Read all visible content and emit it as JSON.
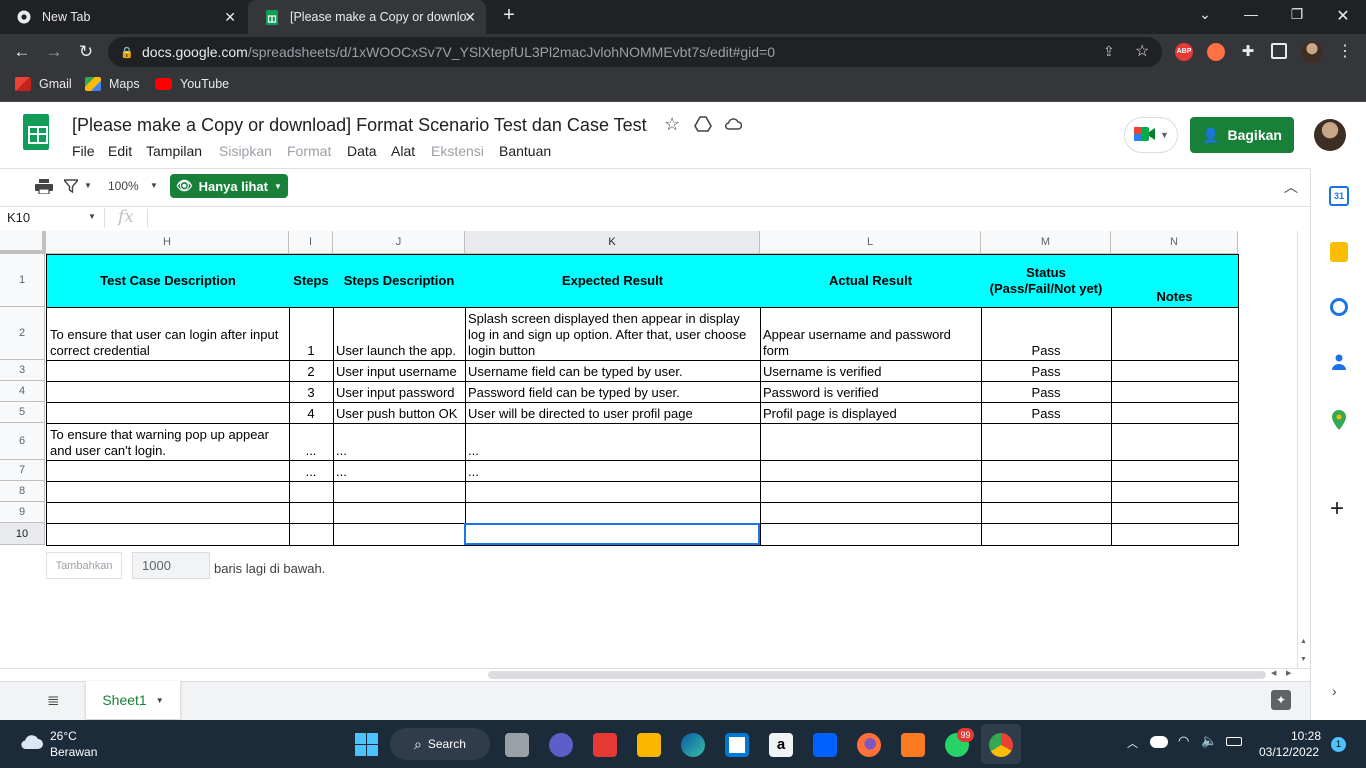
{
  "browser": {
    "tabs": [
      {
        "title": "New Tab"
      },
      {
        "title": "[Please make a Copy or downloa"
      }
    ],
    "url_host": "docs.google.com",
    "url_path": "/spreadsheets/d/1xWOOCxSv7V_YSlXtepfUL3Pl2macJvlohNOMMEvbt7s/edit#gid=0",
    "bookmarks": [
      {
        "label": "Gmail"
      },
      {
        "label": "Maps"
      },
      {
        "label": "YouTube"
      }
    ],
    "abp_label": "ABP"
  },
  "doc": {
    "title": "[Please make a Copy or download] Format  Scenario Test dan Case Test",
    "menus": [
      "File",
      "Edit",
      "Tampilan",
      "Sisipkan",
      "Format",
      "Data",
      "Alat",
      "Ekstensi",
      "Bantuan"
    ],
    "share_label": "Bagikan",
    "zoom": "100%",
    "view_only_label": "Hanya lihat",
    "name_box": "K10",
    "fx_label": "fx"
  },
  "sheet": {
    "columns": [
      "H",
      "I",
      "J",
      "K",
      "L",
      "M",
      "N"
    ],
    "rows": [
      "1",
      "2",
      "3",
      "4",
      "5",
      "6",
      "7",
      "8",
      "9",
      "10"
    ],
    "header": [
      "Test Case Description",
      "Steps",
      "Steps Description",
      "Expected Result",
      "Actual Result",
      "Status (Pass/Fail/Not yet)",
      "Notes"
    ],
    "data": [
      [
        "To ensure that user can login after input correct credential",
        "1",
        "User launch the app.",
        "Splash screen displayed then appear in display log in and sign up option. After that, user choose login button",
        "Appear username and password form",
        "Pass",
        ""
      ],
      [
        "",
        "2",
        "User input username",
        "Username field can be typed by user.",
        "Username is verified",
        "Pass",
        ""
      ],
      [
        "",
        "3",
        "User input password",
        "Password field can be typed by user.",
        "Password is verified",
        "Pass",
        ""
      ],
      [
        "",
        "4",
        "User push button OK",
        "User will be directed to user profil page",
        "Profil page is displayed",
        "Pass",
        ""
      ],
      [
        "To ensure that warning pop up appear and user can't login.",
        "...",
        "...",
        "...",
        "",
        "",
        ""
      ],
      [
        "",
        "...",
        "...",
        "...",
        "",
        "",
        ""
      ],
      [
        "",
        "",
        "",
        "",
        "",
        "",
        ""
      ],
      [
        "",
        "",
        "",
        "",
        "",
        "",
        ""
      ],
      [
        "",
        "",
        "",
        "",
        "",
        "",
        ""
      ]
    ],
    "add_label": "Tambahkan",
    "add_count": "1000",
    "add_suffix": "baris lagi di bawah.",
    "sheet_tab": "Sheet1"
  },
  "taskbar": {
    "temp": "26°C",
    "weather": "Berawan",
    "search": "Search",
    "time": "10:28",
    "date": "03/12/2022",
    "whatsapp_badge": "99",
    "notif_count": "1"
  }
}
